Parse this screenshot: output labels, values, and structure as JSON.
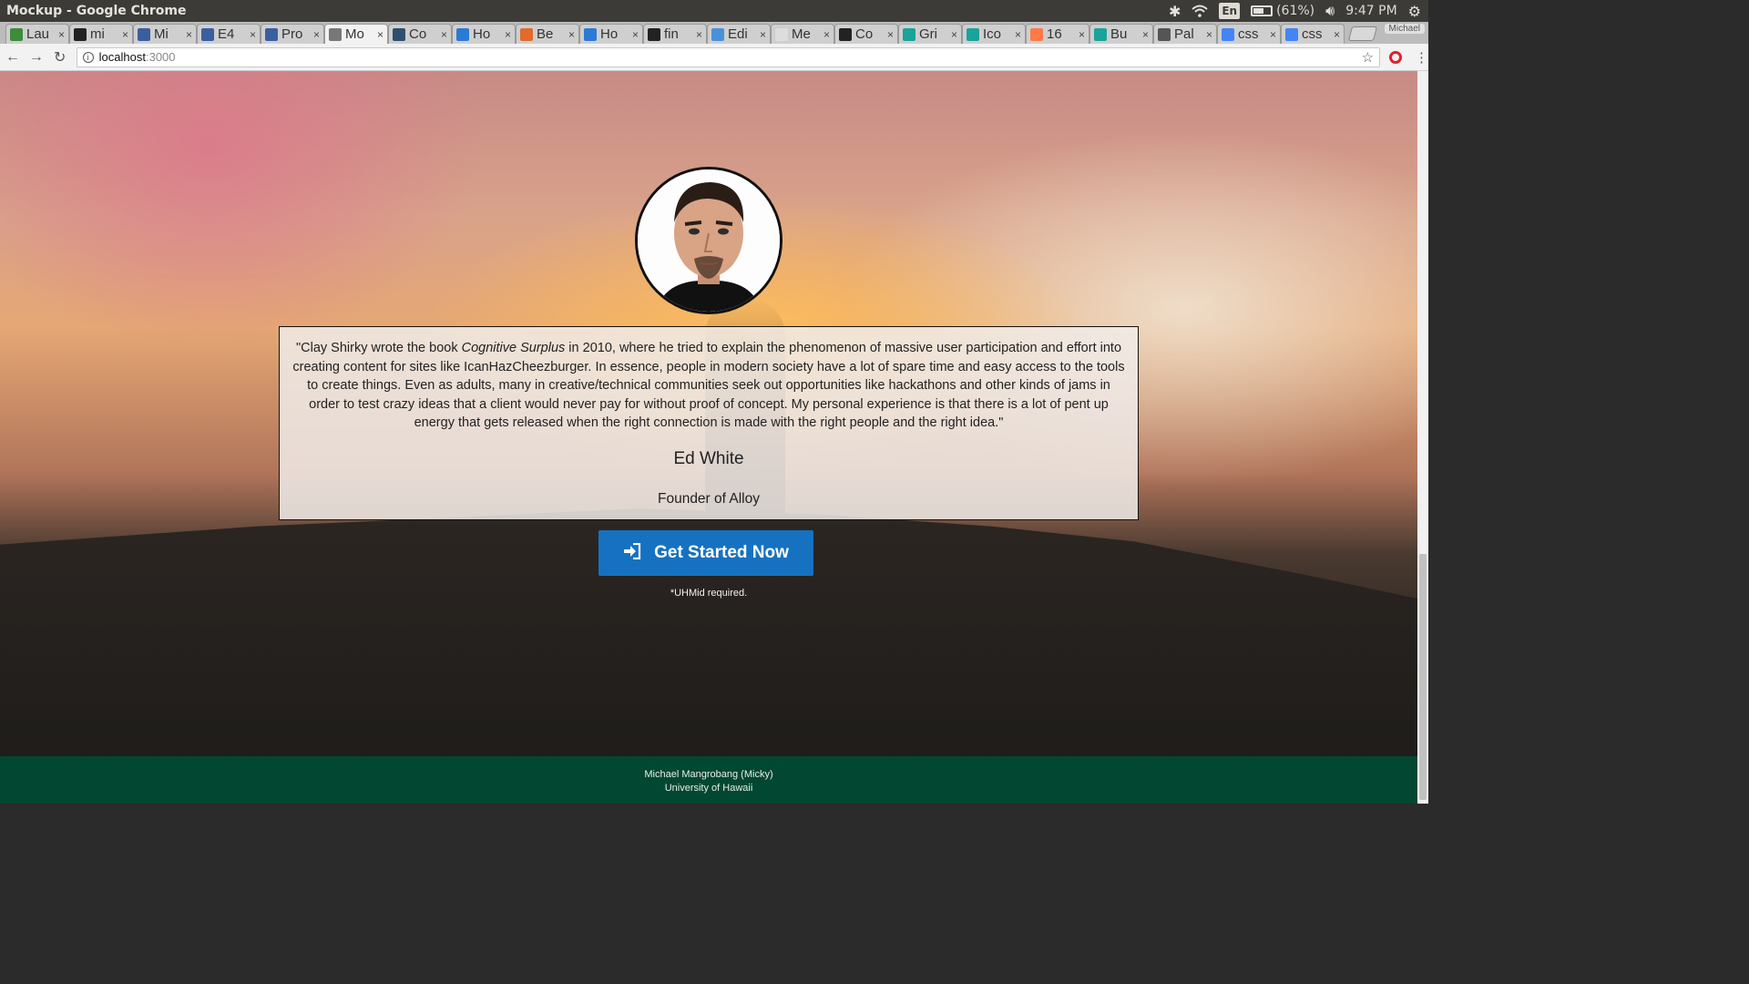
{
  "os_bar": {
    "window_title": "Mockup - Google Chrome",
    "lang": "En",
    "battery": "(61%)",
    "battery_level": 0.61,
    "time": "9:47 PM"
  },
  "tabs": [
    {
      "title": "Lau",
      "icon": "leaf-icon",
      "color": "#3d8b3d"
    },
    {
      "title": "mi",
      "icon": "github-icon",
      "color": "#222222"
    },
    {
      "title": "Mi",
      "icon": "doc-icon",
      "color": "#3a5f9e"
    },
    {
      "title": "E4",
      "icon": "doc-icon",
      "color": "#3a5f9e"
    },
    {
      "title": "Pro",
      "icon": "doc-icon",
      "color": "#3a5f9e"
    },
    {
      "title": "Mo",
      "icon": "page-icon",
      "color": "#777777",
      "active": true
    },
    {
      "title": "Co",
      "icon": "edit-icon",
      "color": "#2f4f6f"
    },
    {
      "title": "Ho",
      "icon": "circle-arrow-icon",
      "color": "#2b7bd6"
    },
    {
      "title": "Be",
      "icon": "behance-icon",
      "color": "#e06b2b"
    },
    {
      "title": "Ho",
      "icon": "circle-arrow-icon",
      "color": "#2b7bd6"
    },
    {
      "title": "fin",
      "icon": "github-icon",
      "color": "#222222"
    },
    {
      "title": "Edi",
      "icon": "cloud-icon",
      "color": "#4a90d9"
    },
    {
      "title": "Me",
      "icon": "blank-icon",
      "color": "#dddddd"
    },
    {
      "title": "Co",
      "icon": "camera-icon",
      "color": "#222222"
    },
    {
      "title": "Gri",
      "icon": "s-icon",
      "color": "#1aa39b"
    },
    {
      "title": "Ico",
      "icon": "s-icon",
      "color": "#1aa39b"
    },
    {
      "title": "16",
      "icon": "hubspot-icon",
      "color": "#ff7a45"
    },
    {
      "title": "Bu",
      "icon": "s-icon",
      "color": "#1aa39b"
    },
    {
      "title": "Pal",
      "icon": "compass-icon",
      "color": "#555555"
    },
    {
      "title": "css",
      "icon": "google-icon",
      "color": "#4285f4"
    },
    {
      "title": "css",
      "icon": "google-icon",
      "color": "#4285f4"
    }
  ],
  "profile_name": "Michael",
  "toolbar": {
    "url_host": "localhost",
    "url_port": ":3000"
  },
  "quote": {
    "before_book": "\"Clay Shirky wrote the book ",
    "book": "Cognitive Surplus",
    "after_book": " in 2010, where he tried to explain the phenomenon of massive user participation and effort into creating content for sites like IcanHazCheezburger. In essence, people in modern society have a lot of spare time and easy access to the tools to create things. Even as adults, many in creative/technical communities seek out opportunities like hackathons and other kinds of jams in order to test crazy ideas that a client would never pay for without proof of concept. My personal experience is that there is a lot of pent up energy that gets released when the right connection is made with the right people and the right idea.\"",
    "name": "Ed White",
    "role": "Founder of Alloy"
  },
  "cta": {
    "label": "Get Started Now",
    "requirement": "*UHMid required."
  },
  "footer": {
    "line1": "Michael Mangrobang (Micky)",
    "line2": "University of Hawaii"
  },
  "colors": {
    "cta": "#1672c0",
    "footer": "#024731"
  }
}
